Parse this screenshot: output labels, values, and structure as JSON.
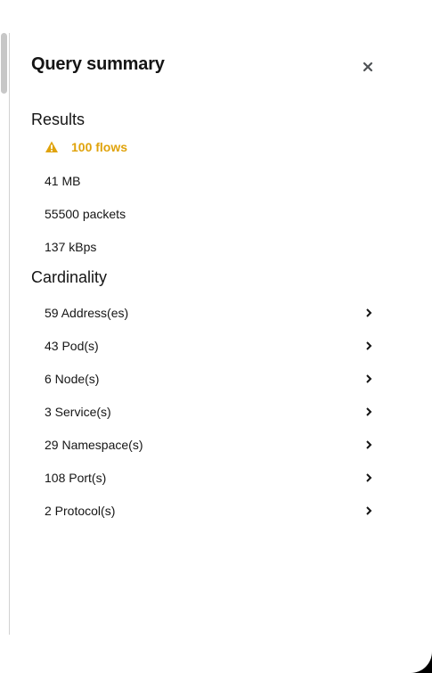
{
  "drawer": {
    "title": "Query summary"
  },
  "results": {
    "heading": "Results",
    "warning_flows": "100 flows",
    "size": "41 MB",
    "packets": "55500 packets",
    "rate": "137 kBps"
  },
  "cardinality": {
    "heading": "Cardinality",
    "items": [
      {
        "label": "59 Address(es)"
      },
      {
        "label": "43 Pod(s)"
      },
      {
        "label": "6 Node(s)"
      },
      {
        "label": "3 Service(s)"
      },
      {
        "label": "29 Namespace(s)"
      },
      {
        "label": "108 Port(s)"
      },
      {
        "label": "2 Protocol(s)"
      }
    ]
  },
  "colors": {
    "warning": "#e0a30b",
    "text": "#151515",
    "background": "#ffffff"
  },
  "icons": {
    "close": "close-icon",
    "warning": "warning-triangle-icon",
    "chevron": "chevron-right-icon"
  }
}
